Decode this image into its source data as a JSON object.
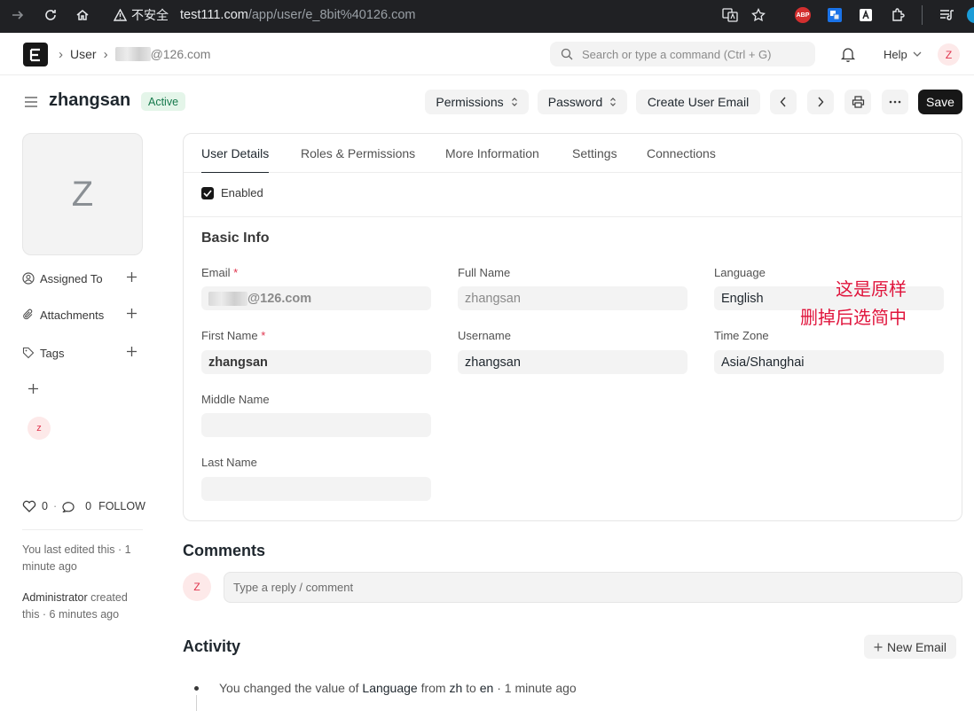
{
  "browser": {
    "security_label": "不安全",
    "url_host": "test111.com",
    "url_path": "/app/user/e_8bit%40126.com",
    "ext_abp": "ABP"
  },
  "navbar": {
    "logo": "E",
    "breadcrumb_user": "User",
    "breadcrumb_email": "@126.com",
    "search_placeholder": "Search or type a command (Ctrl + G)",
    "help": "Help",
    "avatar": "Z"
  },
  "page": {
    "title": "zhangsan",
    "status": "Active",
    "buttons": {
      "permissions": "Permissions",
      "password": "Password",
      "create_email": "Create User Email",
      "save": "Save"
    }
  },
  "sidebar": {
    "avatar_letter": "Z",
    "assigned_to": "Assigned To",
    "attachments": "Attachments",
    "tags": "Tags",
    "user_avatar": "z",
    "likes": "0",
    "comments": "0",
    "follow": "FOLLOW",
    "last_edit_prefix": "You last edited this · 1 minute ago",
    "created_by": "Administrator",
    "created_suffix": " created this · 6 minutes ago"
  },
  "tabs": [
    "User Details",
    "Roles & Permissions",
    "More Information",
    "Settings",
    "Connections"
  ],
  "form": {
    "enabled_label": "Enabled",
    "section": "Basic Info",
    "email_label": "Email",
    "email_value": "@126.com",
    "first_name_label": "First Name",
    "first_name_value": "zhangsan",
    "middle_name_label": "Middle Name",
    "last_name_label": "Last Name",
    "full_name_label": "Full Name",
    "full_name_value": "zhangsan",
    "username_label": "Username",
    "username_value": "zhangsan",
    "language_label": "Language",
    "language_value": "English",
    "timezone_label": "Time Zone",
    "timezone_value": "Asia/Shanghai",
    "required_mark": "*"
  },
  "annotation": {
    "line1": "这是原样",
    "line2": "删掉后选简中"
  },
  "comments": {
    "title": "Comments",
    "avatar": "Z",
    "placeholder": "Type a reply / comment"
  },
  "activity": {
    "title": "Activity",
    "new_email": "New Email",
    "item_prefix": "You changed the value of ",
    "item_field": "Language",
    "item_from": " from ",
    "item_old": "zh",
    "item_to": " to ",
    "item_new": "en",
    "item_time": " · 1 minute ago"
  },
  "colors": {
    "accent": "#171717",
    "active_badge_bg": "#e4f5e9",
    "active_badge_text": "#16794c",
    "avatar_bg": "#fde9e9",
    "avatar_text": "#e0344d",
    "annotation": "#e0143c"
  }
}
